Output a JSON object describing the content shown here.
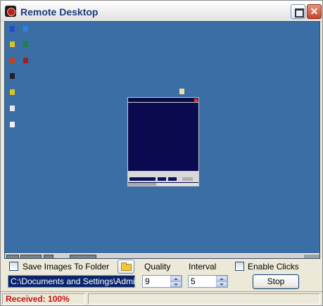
{
  "window": {
    "title": "Remote Desktop",
    "accent": "#1a3a7a",
    "desktop_color": "#3a6ea5"
  },
  "titlebar": {
    "icon": "remote-desktop-app-icon",
    "maximize_icon": "maximize-icon",
    "close_icon": "close-icon"
  },
  "controls": {
    "save_images_label": "Save Images To Folder",
    "save_images_checked": false,
    "browse_icon": "folder-open-icon",
    "folder_path": "C:\\Documents and Settings\\Administ",
    "quality_label": "Quality",
    "quality_value": "9",
    "interval_label": "Interval",
    "interval_value": "5",
    "enable_clicks_label": "Enable Clicks",
    "enable_clicks_checked": false,
    "stop_label": "Stop"
  },
  "status": {
    "received": "Received: 100%",
    "received_color": "#c81010"
  }
}
